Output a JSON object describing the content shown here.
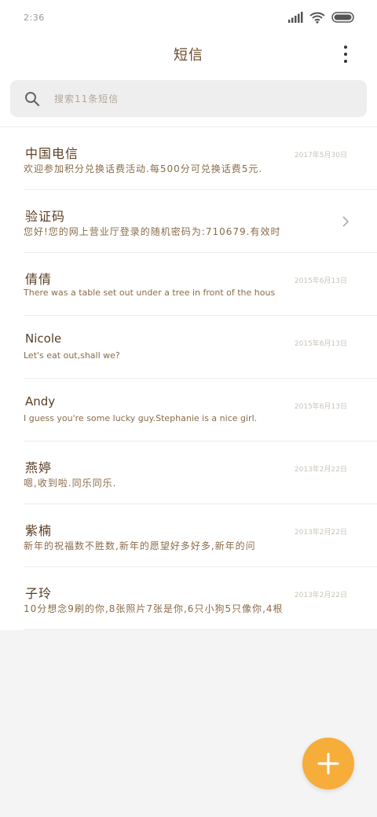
{
  "status_bar": {
    "time": "2:36"
  },
  "header": {
    "title": "短信"
  },
  "search": {
    "placeholder": "搜索11条短信"
  },
  "messages": [
    {
      "name": "中国电信",
      "date": "2017年5月30日",
      "preview": "欢迎参加积分兑换话费活动.每500分可兑换话费5元.",
      "cjk": true
    },
    {
      "name": "验证码",
      "date": "",
      "preview": "您好!您的网上营业厅登录的随机密码为:710679.有效时",
      "cjk": true,
      "chevron": true
    },
    {
      "name": "倩倩",
      "date": "2015年6月13日",
      "preview": "There was a table set out under a tree in front of the hous",
      "cjk_name": true
    },
    {
      "name": "Nicole",
      "date": "2015年6月13日",
      "preview": "Let's eat out,shall we?"
    },
    {
      "name": "Andy",
      "date": "2015年6月13日",
      "preview": "I guess you're some lucky guy.Stephanie is a nice girl."
    },
    {
      "name": "燕婷",
      "date": "2013年2月22日",
      "preview": "嗯,收到啦.同乐同乐.",
      "cjk": true
    },
    {
      "name": "紫楠",
      "date": "2013年2月22日",
      "preview": "新年的祝福数不胜数,新年的愿望好多好多,新年的问",
      "cjk": true
    },
    {
      "name": "子玲",
      "date": "2013年2月22日",
      "preview": "10分想念9刷的你,8张照片7张是你,6只小狗5只像你,4根",
      "cjk": true
    }
  ],
  "colors": {
    "accent": "#f6ad3a",
    "name_text": "#5a3e22",
    "preview_text": "#8a6c4a",
    "date_text": "#c9c2b8"
  },
  "icons": {
    "search": "search-icon",
    "more": "more-vert-icon",
    "add": "plus-icon",
    "chevron": "chevron-right-icon",
    "signal": "signal-icon",
    "wifi": "wifi-icon",
    "battery": "battery-icon"
  }
}
